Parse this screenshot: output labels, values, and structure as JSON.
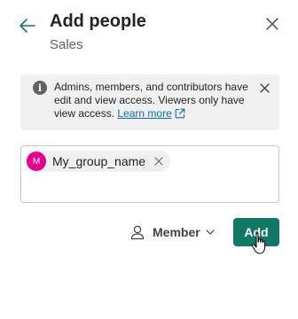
{
  "header": {
    "title": "Add people",
    "subtitle": "Sales",
    "back_icon": "arrow-left-icon",
    "close_icon": "close-icon"
  },
  "info_banner": {
    "icon": "info-icon",
    "icon_glyph": "i",
    "message": "Admins, members, and contributors have edit and view access. Viewers only have view access.",
    "link_label": "Learn more",
    "link_icon": "open-external-icon",
    "dismiss_icon": "close-icon"
  },
  "people_field": {
    "chips": [
      {
        "initial": "M",
        "label": "My_group_name",
        "avatar_color": "#e3008c",
        "remove_icon": "close-icon"
      }
    ]
  },
  "role": {
    "selected": "Member",
    "icon": "person-icon",
    "chevron": "chevron-down-icon"
  },
  "actions": {
    "add_label": "Add"
  },
  "colors": {
    "accent": "#117865",
    "back_arrow": "#117865",
    "link": "#0f6cbd",
    "banner_bg": "#f0f0f0",
    "avatar": "#e3008c"
  }
}
